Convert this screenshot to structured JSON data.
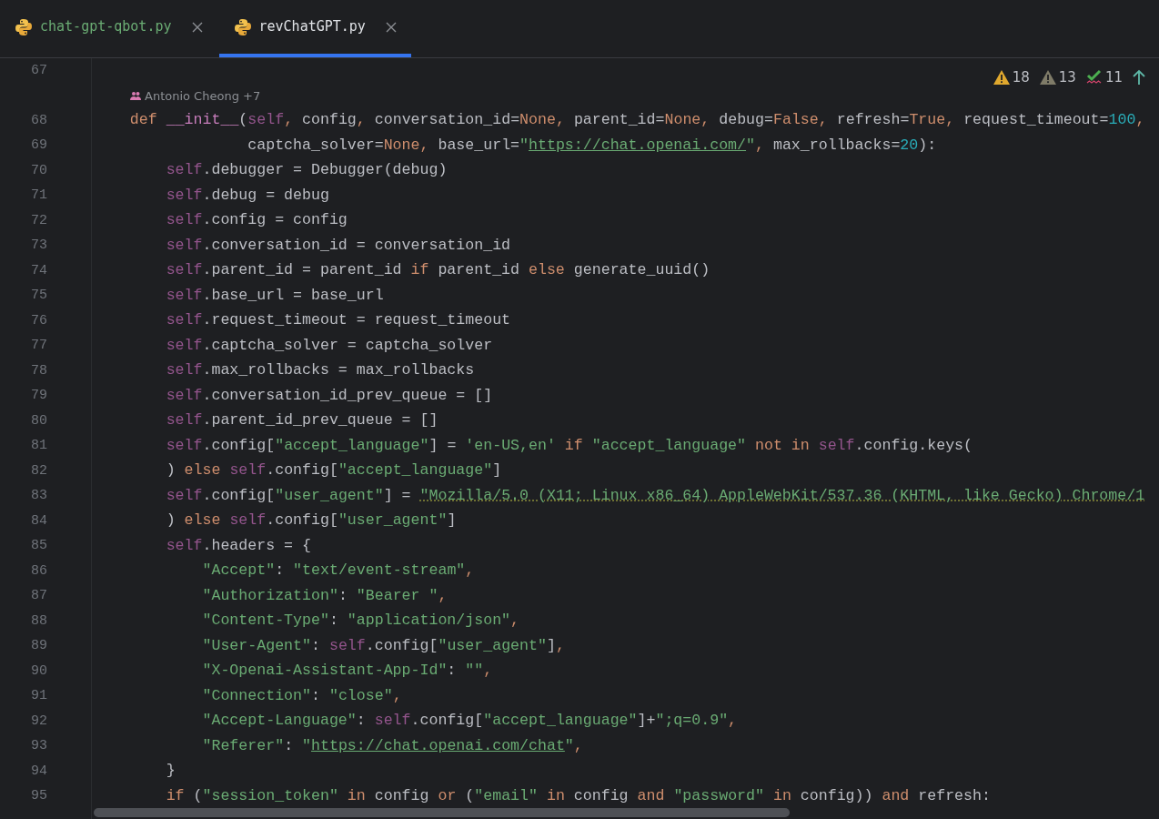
{
  "tabs": [
    {
      "label": "chat-gpt-qbot.py",
      "selected": false,
      "color": "#6aab73"
    },
    {
      "label": "revChatGPT.py",
      "selected": true,
      "color": "#dfe1e5"
    }
  ],
  "inspections": [
    {
      "kind": "warning",
      "count": "18"
    },
    {
      "kind": "weak",
      "count": "13"
    },
    {
      "kind": "typo",
      "count": "11"
    }
  ],
  "lines": [
    {
      "kind": "code",
      "number": "67"
    },
    {
      "kind": "inlay",
      "text": "Antonio Cheong +7"
    },
    {
      "kind": "code",
      "number": "68",
      "tokens": [
        {
          "text": "    def",
          "kind": "kw"
        },
        {
          "text": " __init__",
          "kind": "fn"
        },
        {
          "text": "(",
          "kind": "p"
        },
        {
          "text": "self",
          "kind": "self"
        },
        {
          "text": ",",
          "kind": "kw"
        },
        {
          "text": " config",
          "kind": "p"
        },
        {
          "text": ",",
          "kind": "kw"
        },
        {
          "text": " conversation_id=",
          "kind": "p"
        },
        {
          "text": "None",
          "kind": "kw"
        },
        {
          "text": ",",
          "kind": "kw"
        },
        {
          "text": " parent_id=",
          "kind": "p"
        },
        {
          "text": "None",
          "kind": "kw"
        },
        {
          "text": ",",
          "kind": "kw"
        },
        {
          "text": " debug=",
          "kind": "p"
        },
        {
          "text": "False",
          "kind": "kw"
        },
        {
          "text": ",",
          "kind": "kw"
        },
        {
          "text": " refresh=",
          "kind": "p"
        },
        {
          "text": "True",
          "kind": "kw"
        },
        {
          "text": ",",
          "kind": "kw"
        },
        {
          "text": " request_timeout=",
          "kind": "p"
        },
        {
          "text": "100",
          "kind": "num"
        },
        {
          "text": ",",
          "kind": "kw"
        }
      ]
    },
    {
      "kind": "code",
      "number": "69",
      "tokens": [
        {
          "text": "                 captcha_solver=",
          "kind": "p"
        },
        {
          "text": "None",
          "kind": "kw"
        },
        {
          "text": ",",
          "kind": "kw"
        },
        {
          "text": " base_url=",
          "kind": "p"
        },
        {
          "text": "\"",
          "kind": "str"
        },
        {
          "text": "https://chat.openai.com/",
          "kind": "url"
        },
        {
          "text": "\"",
          "kind": "str"
        },
        {
          "text": ",",
          "kind": "kw"
        },
        {
          "text": " max_rollbacks=",
          "kind": "p"
        },
        {
          "text": "20",
          "kind": "num"
        },
        {
          "text": "):",
          "kind": "p"
        }
      ]
    },
    {
      "kind": "code",
      "number": "70",
      "tokens": [
        {
          "text": "        self",
          "kind": "self"
        },
        {
          "text": ".debugger = Debugger(debug)",
          "kind": "p"
        }
      ]
    },
    {
      "kind": "code",
      "number": "71",
      "tokens": [
        {
          "text": "        self",
          "kind": "self"
        },
        {
          "text": ".debug = debug",
          "kind": "p"
        }
      ]
    },
    {
      "kind": "code",
      "number": "72",
      "tokens": [
        {
          "text": "        self",
          "kind": "self"
        },
        {
          "text": ".config = config",
          "kind": "p"
        }
      ]
    },
    {
      "kind": "code",
      "number": "73",
      "tokens": [
        {
          "text": "        self",
          "kind": "self"
        },
        {
          "text": ".conversation_id = conversation_id",
          "kind": "p"
        }
      ]
    },
    {
      "kind": "code",
      "number": "74",
      "tokens": [
        {
          "text": "        self",
          "kind": "self"
        },
        {
          "text": ".parent_id = parent_id ",
          "kind": "p"
        },
        {
          "text": "if",
          "kind": "kw"
        },
        {
          "text": " parent_id ",
          "kind": "p"
        },
        {
          "text": "else",
          "kind": "kw"
        },
        {
          "text": " generate_uuid()",
          "kind": "p"
        }
      ]
    },
    {
      "kind": "code",
      "number": "75",
      "tokens": [
        {
          "text": "        self",
          "kind": "self"
        },
        {
          "text": ".base_url = base_url",
          "kind": "p"
        }
      ]
    },
    {
      "kind": "code",
      "number": "76",
      "tokens": [
        {
          "text": "        self",
          "kind": "self"
        },
        {
          "text": ".request_timeout = request_timeout",
          "kind": "p"
        }
      ]
    },
    {
      "kind": "code",
      "number": "77",
      "tokens": [
        {
          "text": "        self",
          "kind": "self"
        },
        {
          "text": ".captcha_solver = captcha_solver",
          "kind": "p"
        }
      ]
    },
    {
      "kind": "code",
      "number": "78",
      "tokens": [
        {
          "text": "        self",
          "kind": "self"
        },
        {
          "text": ".max_rollbacks = max_rollbacks",
          "kind": "p"
        }
      ]
    },
    {
      "kind": "code",
      "number": "79",
      "tokens": [
        {
          "text": "        self",
          "kind": "self"
        },
        {
          "text": ".conversation_id_prev_queue = []",
          "kind": "p"
        }
      ]
    },
    {
      "kind": "code",
      "number": "80",
      "tokens": [
        {
          "text": "        self",
          "kind": "self"
        },
        {
          "text": ".parent_id_prev_queue = []",
          "kind": "p"
        }
      ]
    },
    {
      "kind": "code",
      "number": "81",
      "tokens": [
        {
          "text": "        self",
          "kind": "self"
        },
        {
          "text": ".config[",
          "kind": "p"
        },
        {
          "text": "\"accept_language\"",
          "kind": "str"
        },
        {
          "text": "] = ",
          "kind": "p"
        },
        {
          "text": "'en-US,en'",
          "kind": "str"
        },
        {
          "text": " if",
          "kind": "kw"
        },
        {
          "text": " \"accept_language\"",
          "kind": "str"
        },
        {
          "text": " not in",
          "kind": "kw"
        },
        {
          "text": " self",
          "kind": "self"
        },
        {
          "text": ".config.keys(",
          "kind": "p"
        }
      ]
    },
    {
      "kind": "code",
      "number": "82",
      "tokens": [
        {
          "text": "        )",
          "kind": "p"
        },
        {
          "text": " else",
          "kind": "kw"
        },
        {
          "text": " self",
          "kind": "self"
        },
        {
          "text": ".config[",
          "kind": "p"
        },
        {
          "text": "\"accept_language\"",
          "kind": "str"
        },
        {
          "text": "]",
          "kind": "p"
        }
      ]
    },
    {
      "kind": "code",
      "number": "83",
      "tokens": [
        {
          "text": "        self",
          "kind": "self"
        },
        {
          "text": ".config[",
          "kind": "p"
        },
        {
          "text": "\"user_agent\"",
          "kind": "str"
        },
        {
          "text": "] = ",
          "kind": "p"
        },
        {
          "text": "\"Mozilla/5.0 (X11; Linux x86_64) AppleWebKit/537.36 (KHTML, like Gecko) Chrome/1",
          "kind": "typo"
        }
      ]
    },
    {
      "kind": "code",
      "number": "84",
      "tokens": [
        {
          "text": "        )",
          "kind": "p"
        },
        {
          "text": " else",
          "kind": "kw"
        },
        {
          "text": " self",
          "kind": "self"
        },
        {
          "text": ".config[",
          "kind": "p"
        },
        {
          "text": "\"user_agent\"",
          "kind": "str"
        },
        {
          "text": "]",
          "kind": "p"
        }
      ]
    },
    {
      "kind": "code",
      "number": "85",
      "tokens": [
        {
          "text": "        self",
          "kind": "self"
        },
        {
          "text": ".headers = {",
          "kind": "p"
        }
      ]
    },
    {
      "kind": "code",
      "number": "86",
      "tokens": [
        {
          "text": "            \"Accept\"",
          "kind": "str"
        },
        {
          "text": ": ",
          "kind": "p"
        },
        {
          "text": "\"text/event-stream\"",
          "kind": "str"
        },
        {
          "text": ",",
          "kind": "kw"
        }
      ]
    },
    {
      "kind": "code",
      "number": "87",
      "tokens": [
        {
          "text": "            \"Authorization\"",
          "kind": "str"
        },
        {
          "text": ": ",
          "kind": "p"
        },
        {
          "text": "\"Bearer \"",
          "kind": "str"
        },
        {
          "text": ",",
          "kind": "kw"
        }
      ]
    },
    {
      "kind": "code",
      "number": "88",
      "tokens": [
        {
          "text": "            \"Content-Type\"",
          "kind": "str"
        },
        {
          "text": ": ",
          "kind": "p"
        },
        {
          "text": "\"application/json\"",
          "kind": "str"
        },
        {
          "text": ",",
          "kind": "kw"
        }
      ]
    },
    {
      "kind": "code",
      "number": "89",
      "tokens": [
        {
          "text": "            \"User-Agent\"",
          "kind": "str"
        },
        {
          "text": ": ",
          "kind": "p"
        },
        {
          "text": "self",
          "kind": "self"
        },
        {
          "text": ".config[",
          "kind": "p"
        },
        {
          "text": "\"user_agent\"",
          "kind": "str"
        },
        {
          "text": "]",
          "kind": "p"
        },
        {
          "text": ",",
          "kind": "kw"
        }
      ]
    },
    {
      "kind": "code",
      "number": "90",
      "tokens": [
        {
          "text": "            \"X-Openai-Assistant-App-Id\"",
          "kind": "str"
        },
        {
          "text": ": ",
          "kind": "p"
        },
        {
          "text": "\"\"",
          "kind": "str"
        },
        {
          "text": ",",
          "kind": "kw"
        }
      ]
    },
    {
      "kind": "code",
      "number": "91",
      "tokens": [
        {
          "text": "            \"Connection\"",
          "kind": "str"
        },
        {
          "text": ": ",
          "kind": "p"
        },
        {
          "text": "\"close\"",
          "kind": "str"
        },
        {
          "text": ",",
          "kind": "kw"
        }
      ]
    },
    {
      "kind": "code",
      "number": "92",
      "tokens": [
        {
          "text": "            \"Accept-Language\"",
          "kind": "str"
        },
        {
          "text": ": ",
          "kind": "p"
        },
        {
          "text": "self",
          "kind": "self"
        },
        {
          "text": ".config[",
          "kind": "p"
        },
        {
          "text": "\"accept_language\"",
          "kind": "str"
        },
        {
          "text": "]+",
          "kind": "p"
        },
        {
          "text": "\";q=0.9\"",
          "kind": "str"
        },
        {
          "text": ",",
          "kind": "kw"
        }
      ]
    },
    {
      "kind": "code",
      "number": "93",
      "tokens": [
        {
          "text": "            \"Referer\"",
          "kind": "str"
        },
        {
          "text": ": ",
          "kind": "p"
        },
        {
          "text": "\"",
          "kind": "str"
        },
        {
          "text": "https://chat.openai.com/chat",
          "kind": "url"
        },
        {
          "text": "\"",
          "kind": "str"
        },
        {
          "text": ",",
          "kind": "kw"
        }
      ]
    },
    {
      "kind": "code",
      "number": "94",
      "tokens": [
        {
          "text": "        }",
          "kind": "p"
        }
      ]
    },
    {
      "kind": "code",
      "number": "95",
      "tokens": [
        {
          "text": "        if",
          "kind": "kw"
        },
        {
          "text": " (",
          "kind": "p"
        },
        {
          "text": "\"session_token\"",
          "kind": "str"
        },
        {
          "text": " in",
          "kind": "kw"
        },
        {
          "text": " config ",
          "kind": "p"
        },
        {
          "text": "or",
          "kind": "kw"
        },
        {
          "text": " (",
          "kind": "p"
        },
        {
          "text": "\"email\"",
          "kind": "str"
        },
        {
          "text": " in",
          "kind": "kw"
        },
        {
          "text": " config ",
          "kind": "p"
        },
        {
          "text": "and",
          "kind": "kw"
        },
        {
          "text": " \"password\"",
          "kind": "str"
        },
        {
          "text": " in",
          "kind": "kw"
        },
        {
          "text": " config)) ",
          "kind": "p"
        },
        {
          "text": "and",
          "kind": "kw"
        },
        {
          "text": " refresh:",
          "kind": "p"
        }
      ]
    }
  ]
}
